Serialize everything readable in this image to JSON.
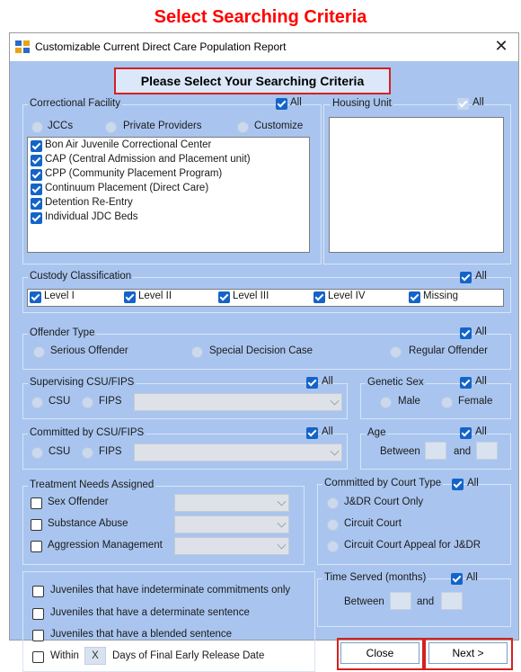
{
  "page_heading": "Select Searching Criteria",
  "window": {
    "title": "Customizable Current Direct Care Population Report",
    "close_glyph": "✕"
  },
  "subtitle": "Please Select Your Searching Criteria",
  "all_label": "All",
  "correctional_facility": {
    "legend": "Correctional Facility",
    "options": [
      "JCCs",
      "Private Providers",
      "Customize"
    ],
    "items": [
      "Bon Air Juvenile Correctional Center",
      "CAP (Central Admission and Placement unit)",
      "CPP (Community Placement Program)",
      "Continuum Placement (Direct Care)",
      "Detention Re-Entry",
      "Individual JDC Beds"
    ]
  },
  "housing_unit": {
    "legend": "Housing Unit"
  },
  "custody": {
    "legend": "Custody Classification",
    "levels": [
      "Level I",
      "Level II",
      "Level III",
      "Level IV",
      "Missing"
    ]
  },
  "offender_type": {
    "legend": "Offender Type",
    "options": [
      "Serious Offender",
      "Special Decision Case",
      "Regular Offender"
    ]
  },
  "supervising": {
    "legend": "Supervising CSU/FIPS",
    "options": [
      "CSU",
      "FIPS"
    ]
  },
  "genetic_sex": {
    "legend": "Genetic Sex",
    "options": [
      "Male",
      "Female"
    ]
  },
  "committed_csu": {
    "legend": "Committed by CSU/FIPS",
    "options": [
      "CSU",
      "FIPS"
    ]
  },
  "age": {
    "legend": "Age",
    "between": "Between",
    "and": "and"
  },
  "treatment": {
    "legend": "Treatment Needs Assigned",
    "items": [
      "Sex Offender",
      "Substance Abuse",
      "Aggression Management"
    ]
  },
  "court_type": {
    "legend": "Committed by Court Type",
    "options": [
      "J&DR Court Only",
      "Circuit Court",
      "Circuit Court Appeal for J&DR"
    ]
  },
  "juvenile_checks": [
    "Juveniles that have indeterminate commitments only",
    "Juveniles that have a determinate sentence",
    "Juveniles that have a blended sentence"
  ],
  "within": {
    "prefix": "Within",
    "value": "X",
    "suffix": "Days of Final Early Release Date"
  },
  "time_served": {
    "legend": "Time Served (months)",
    "between": "Between",
    "and": "and"
  },
  "buttons": {
    "close": "Close",
    "next": "Next >"
  },
  "colors": {
    "dialog_bg": "#a9c5ef",
    "heading": "#ff0000",
    "highlight_border": "#d62020",
    "checkbox": "#1464c8"
  }
}
